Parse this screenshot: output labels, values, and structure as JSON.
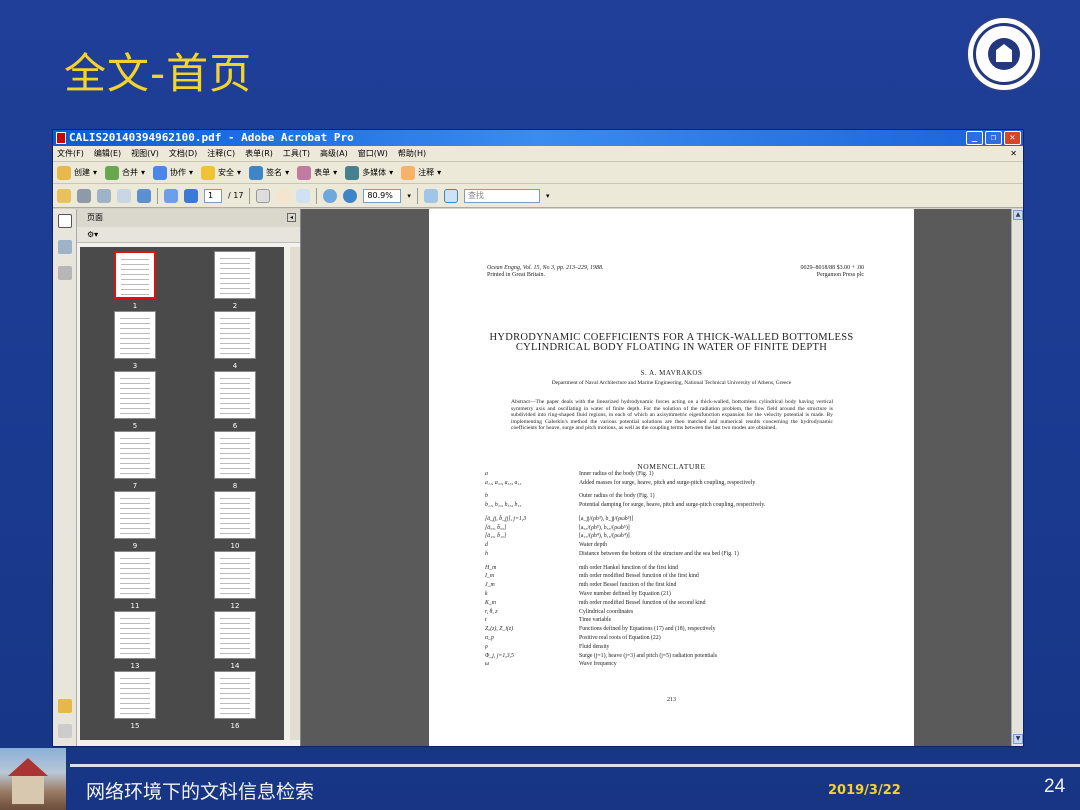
{
  "slide": {
    "title": "全文-首页",
    "footer_text": "网络环境下的文科信息检索",
    "footer_date": "2019/3/22",
    "page_number": "24"
  },
  "window": {
    "title": "CALIS20140394962100.pdf - Adobe Acrobat Pro",
    "menu": [
      "文件(F)",
      "编辑(E)",
      "视图(V)",
      "文档(D)",
      "注释(C)",
      "表单(R)",
      "工具(T)",
      "高级(A)",
      "窗口(W)",
      "帮助(H)"
    ],
    "tools1": [
      "创建",
      "合并",
      "协作",
      "安全",
      "签名",
      "表单",
      "多媒体",
      "注释"
    ],
    "page_current": "1",
    "page_total": "/ 17",
    "zoom": "80.9%",
    "find_placeholder": "查找"
  },
  "panel": {
    "title": "页面",
    "thumbnails": [
      "1",
      "2",
      "3",
      "4",
      "5",
      "6",
      "7",
      "8",
      "9",
      "10",
      "11",
      "12",
      "13",
      "14",
      "15",
      "16"
    ],
    "selected": "1"
  },
  "document": {
    "header_left_1": "Ocean Engng, Vol. 15, No 3, pp. 213–229, 1988.",
    "header_left_2": "Printed in Great Britain.",
    "header_right_1": "0029–8018/88 $3.00 + .00",
    "header_right_2": "Pergamon Press plc",
    "title": "HYDRODYNAMIC COEFFICIENTS FOR A THICK-WALLED BOTTOMLESS CYLINDRICAL BODY FLOATING IN WATER OF FINITE DEPTH",
    "author": "S. A. MAVRAKOS",
    "affiliation": "Department of Naval Architecture and Marine Engineering, National Technical University of Athens, Greece",
    "abstract": "Abstract—The paper deals with the linearized hydrodynamic forces acting on a thick-walled, bottomless cylindrical body having vertical symmetry axis and oscillating in water of finite depth. For the solution of the radiation problem, the flow field around the structure is subdivided into ring-shaped fluid regions, in each of which an axisymmetric eigenfunction expansion for the velocity potential is made. By implementing Galerkin's method the various potential solutions are then matched and numerical results concerning the hydrodynamic coefficients for heave, surge and pitch motions, as well as the coupling terms between the last two modes are obtained.",
    "nomenclature_title": "NOMENCLATURE",
    "nomenclature": [
      {
        "sym": "a",
        "def": "Inner radius of the body (Fig. 1)"
      },
      {
        "sym": "a₁₁, a₃₃, a₅₅, a₁₅",
        "def": "Added masses for surge, heave, pitch and surge-pitch coupling, respectively"
      },
      {
        "sym": "b",
        "def": "Outer radius of the body (Fig. 1)"
      },
      {
        "sym": "b₁₁, b₃₃, b₅₅, b₁₅",
        "def": "Potential damping for surge, heave, pitch and surge-pitch coupling, respectively."
      },
      {
        "sym": "[ā_jj, b̄_jj], j=1,3",
        "def": "[a_jj/(ρb³), b_jj/(ρωb³)]"
      },
      {
        "sym": "[ā₅₅, b̄₅₅]",
        "def": "[a₅₅/(ρb⁵), b₅₅/(ρωb⁵)]"
      },
      {
        "sym": "[ā₁₅, b̄₁₅]",
        "def": "[a₁₅/(ρb⁴), b₁₅/(ρωb⁴)]"
      },
      {
        "sym": "d",
        "def": "Water depth"
      },
      {
        "sym": "h",
        "def": "Distance between the bottom of the structure and the sea bed (Fig. 1)"
      },
      {
        "sym": "H_m",
        "def": "mth order Hankel function of the first kind"
      },
      {
        "sym": "I_m",
        "def": "mth order modified Bessel function of the first kind"
      },
      {
        "sym": "J_m",
        "def": "mth order Bessel function of the first kind"
      },
      {
        "sym": "k",
        "def": "Wave number defined by Equation (21)"
      },
      {
        "sym": "K_m",
        "def": "mth order modified Bessel function of the second kind"
      },
      {
        "sym": "r, θ, z",
        "def": "Cylindrical coordinates"
      },
      {
        "sym": "t",
        "def": "Time variable"
      },
      {
        "sym": "Z₀(z), Z_i(z)",
        "def": "Functions defined by Equations (17) and (18), respectively"
      },
      {
        "sym": "α_p",
        "def": "Positive real roots of Equation (22)"
      },
      {
        "sym": "ρ",
        "def": "Fluid density"
      },
      {
        "sym": "Φ_j, j=1,3,5",
        "def": "Surge (j=1), heave (j=3) and pitch (j=5) radiation potentials"
      },
      {
        "sym": "ω",
        "def": "Wave frequency"
      }
    ],
    "page_number": "213"
  }
}
